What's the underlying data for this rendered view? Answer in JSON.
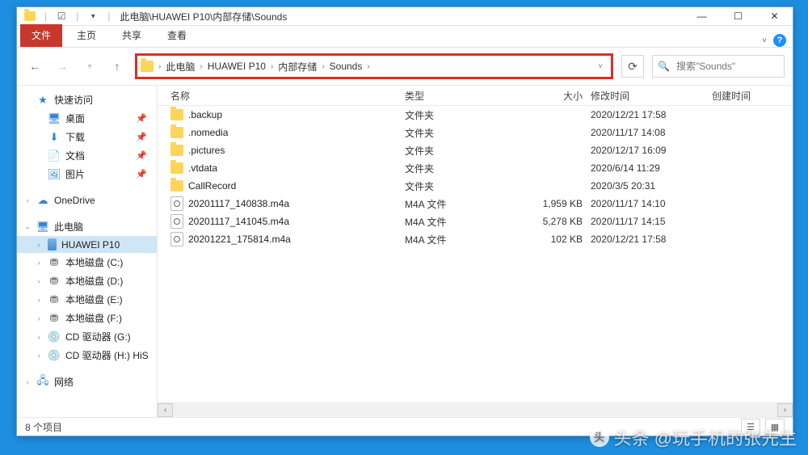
{
  "titlebar": {
    "path": "此电脑\\HUAWEI P10\\内部存储\\Sounds"
  },
  "ribbon": {
    "file": "文件",
    "home": "主页",
    "share": "共享",
    "view": "查看"
  },
  "nav": {
    "breadcrumb": [
      "此电脑",
      "HUAWEI P10",
      "内部存储",
      "Sounds"
    ]
  },
  "search": {
    "placeholder": "搜索\"Sounds\""
  },
  "sidebar": {
    "quick": {
      "label": "快速访问"
    },
    "quick_items": [
      {
        "label": "桌面",
        "icon": "desktop",
        "pinned": true
      },
      {
        "label": "下载",
        "icon": "down",
        "pinned": true
      },
      {
        "label": "文档",
        "icon": "doc",
        "pinned": true
      },
      {
        "label": "图片",
        "icon": "pic",
        "pinned": true
      }
    ],
    "onedrive": "OneDrive",
    "thispc": "此电脑",
    "pc_items": [
      {
        "label": "HUAWEI P10",
        "icon": "phone",
        "selected": true
      },
      {
        "label": "本地磁盘 (C:)",
        "icon": "drive"
      },
      {
        "label": "本地磁盘 (D:)",
        "icon": "drive"
      },
      {
        "label": "本地磁盘 (E:)",
        "icon": "drive"
      },
      {
        "label": "本地磁盘 (F:)",
        "icon": "drive"
      },
      {
        "label": "CD 驱动器 (G:)",
        "icon": "cd"
      },
      {
        "label": "CD 驱动器 (H:) HiS",
        "icon": "cdh"
      }
    ],
    "network": "网络"
  },
  "columns": {
    "name": "名称",
    "type": "类型",
    "size": "大小",
    "mtime": "修改时间",
    "ctime": "创建时间"
  },
  "rows": [
    {
      "name": ".backup",
      "type": "文件夹",
      "size": "",
      "mtime": "2020/12/21 17:58",
      "icon": "folder"
    },
    {
      "name": ".nomedia",
      "type": "文件夹",
      "size": "",
      "mtime": "2020/11/17 14:08",
      "icon": "folder"
    },
    {
      "name": ".pictures",
      "type": "文件夹",
      "size": "",
      "mtime": "2020/12/17 16:09",
      "icon": "folder"
    },
    {
      "name": ".vtdata",
      "type": "文件夹",
      "size": "",
      "mtime": "2020/6/14 11:29",
      "icon": "folder"
    },
    {
      "name": "CallRecord",
      "type": "文件夹",
      "size": "",
      "mtime": "2020/3/5 20:31",
      "icon": "folder"
    },
    {
      "name": "20201117_140838.m4a",
      "type": "M4A 文件",
      "size": "1,959 KB",
      "mtime": "2020/11/17 14:10",
      "icon": "m4a"
    },
    {
      "name": "20201117_141045.m4a",
      "type": "M4A 文件",
      "size": "5,278 KB",
      "mtime": "2020/11/17 14:15",
      "icon": "m4a"
    },
    {
      "name": "20201221_175814.m4a",
      "type": "M4A 文件",
      "size": "102 KB",
      "mtime": "2020/12/21 17:58",
      "icon": "m4a"
    }
  ],
  "status": {
    "count": "8 个项目"
  },
  "watermark": "头条 @玩手机的张先生"
}
